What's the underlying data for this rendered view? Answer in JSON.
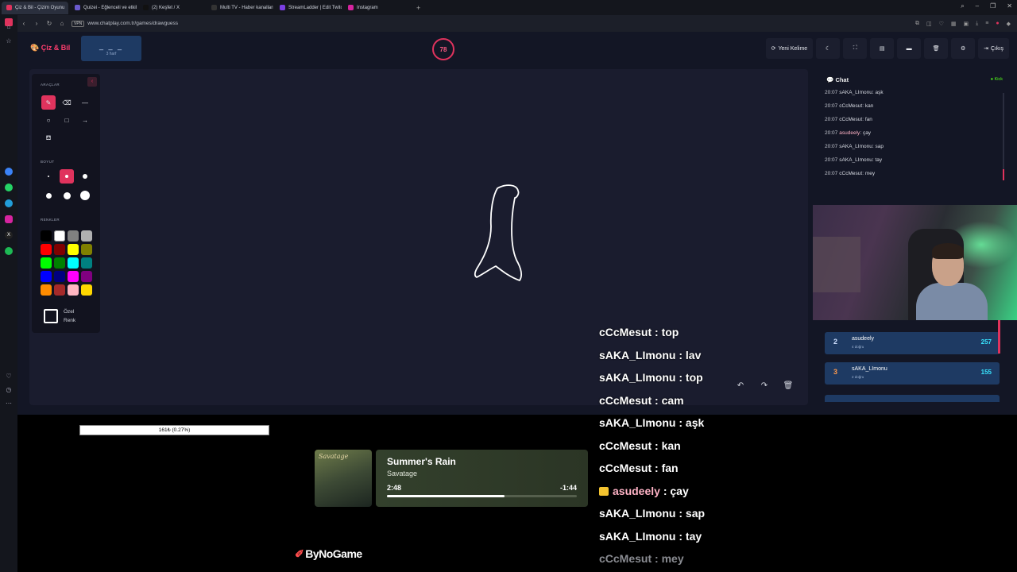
{
  "browser": {
    "tabs": [
      {
        "label": "Çiz & Bil - Çizim Oyunu",
        "color": "#e0335d",
        "active": true
      },
      {
        "label": "Quizei - Eğlenceli ve etkile",
        "color": "#6a5acd"
      },
      {
        "label": "(2) Keşfet / X",
        "color": "#111111"
      },
      {
        "label": "Multi TV - Haber kanalları",
        "color": "#333333"
      },
      {
        "label": "StreamLadder | Edit Twitch",
        "color": "#7b3fe4"
      },
      {
        "label": "Instagram",
        "color": "#d6249f"
      }
    ],
    "new_tab": "+",
    "url": "www.chatplay.com.tr/games/drawguess",
    "vpn": "VPN"
  },
  "app": {
    "logo": "Çiz & Bil",
    "word_dashes": "_ _ _",
    "word_hint": "3 harf",
    "timer": "78",
    "buttons": {
      "new_word": "Yeni Kelime",
      "exit": "Çıkış"
    }
  },
  "tools": {
    "tools_label": "ARAÇLAR",
    "size_label": "BOYUT",
    "colors_label": "RENKLER",
    "custom_color_line1": "Özel",
    "custom_color_line2": "Renk",
    "palette": [
      "#000000",
      "#ffffff",
      "#808080",
      "#b0b0b0",
      "#ff0000",
      "#800000",
      "#ffff00",
      "#808000",
      "#00ff00",
      "#008000",
      "#00ffff",
      "#008080",
      "#0000ff",
      "#000080",
      "#ff00ff",
      "#800080",
      "#ff8c00",
      "#a52a2a",
      "#ffb6c1",
      "#ffd700"
    ]
  },
  "chat": {
    "title": "Chat",
    "platform": "Kick",
    "messages": [
      {
        "time": "20:07",
        "user": "sAKA_LImonu",
        "text": "aşk"
      },
      {
        "time": "20:07",
        "user": "cCcMesut",
        "text": "kan"
      },
      {
        "time": "20:07",
        "user": "cCcMesut",
        "text": "fan"
      },
      {
        "time": "20:07",
        "user": "asudeely",
        "text": "çay"
      },
      {
        "time": "20:07",
        "user": "sAKA_LImonu",
        "text": "sap"
      },
      {
        "time": "20:07",
        "user": "sAKA_LImonu",
        "text": "tay"
      },
      {
        "time": "20:07",
        "user": "cCcMesut",
        "text": "mey"
      }
    ]
  },
  "leaderboard": [
    {
      "rank": "2",
      "name": "asudeely",
      "sub": "4 doğru",
      "score": "257"
    },
    {
      "rank": "3",
      "name": "sAKA_LImonu",
      "sub": "2 doğru",
      "score": "155"
    }
  ],
  "overlay": {
    "progress_text": "161₺ (0.27%)",
    "now_playing": {
      "title": "Summer's Rain",
      "artist": "Savatage",
      "elapsed": "2:48",
      "remaining": "-1:44",
      "progress": 0.62,
      "album_art_text": "Savatage"
    },
    "brand": "ByNoGame",
    "chat": [
      {
        "user": "cCcMesut",
        "text": "top"
      },
      {
        "user": "sAKA_LImonu",
        "text": "lav"
      },
      {
        "user": "sAKA_LImonu",
        "text": "top"
      },
      {
        "user": "cCcMesut",
        "text": "cam"
      },
      {
        "user": "sAKA_LImonu",
        "text": "aşk"
      },
      {
        "user": "cCcMesut",
        "text": "kan"
      },
      {
        "user": "cCcMesut",
        "text": "fan"
      },
      {
        "user": "asudeely",
        "text": "çay",
        "badge": "crown"
      },
      {
        "user": "sAKA_LImonu",
        "text": "sap"
      },
      {
        "user": "sAKA_LImonu",
        "text": "tay"
      },
      {
        "user": "cCcMesut",
        "text": "mey"
      }
    ]
  }
}
